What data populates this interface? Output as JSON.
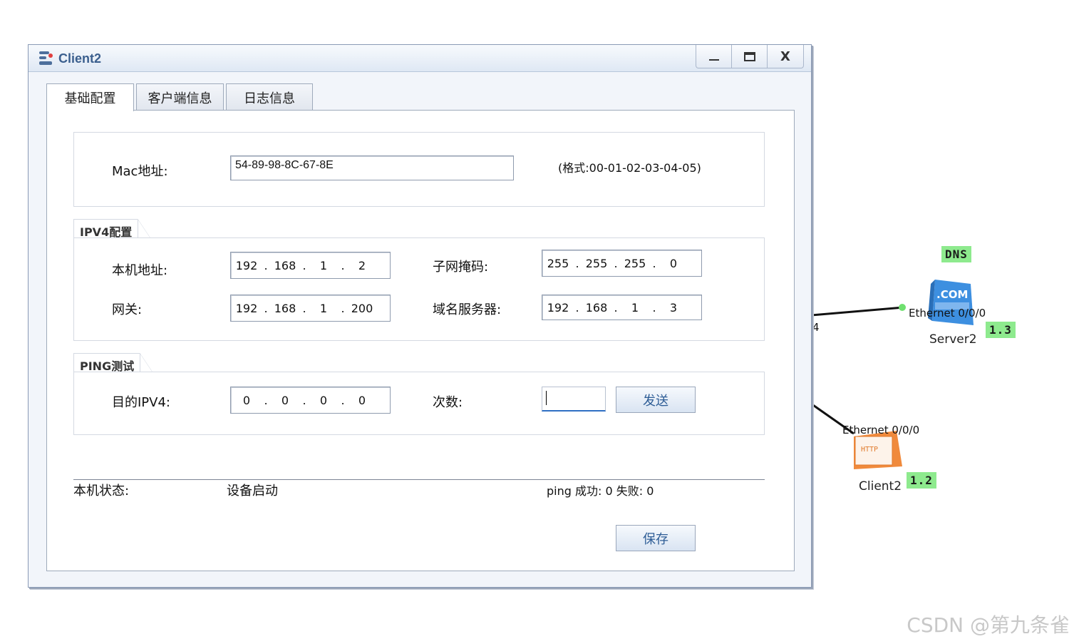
{
  "window": {
    "title": "Client2",
    "minimize": "minimize",
    "maximize": "maximize",
    "close": "X"
  },
  "tabs": [
    {
      "label": "基础配置",
      "active": true
    },
    {
      "label": "客户端信息",
      "active": false
    },
    {
      "label": "日志信息",
      "active": false
    }
  ],
  "mac": {
    "label": "Mac地址:",
    "value": "54-89-98-8C-67-8E",
    "hint": "(格式:00-01-02-03-04-05)"
  },
  "ipv4": {
    "legend": "IPV4配置",
    "local_label": "本机地址:",
    "local": [
      "192",
      "168",
      "1",
      "2"
    ],
    "mask_label": "子网掩码:",
    "mask": [
      "255",
      "255",
      "255",
      "0"
    ],
    "gateway_label": "网关:",
    "gateway": [
      "192",
      "168",
      "1",
      "200"
    ],
    "dns_label": "域名服务器:",
    "dns": [
      "192",
      "168",
      "1",
      "3"
    ]
  },
  "ping": {
    "legend": "PING测试",
    "dest_label": "目的IPV4:",
    "dest": [
      "0",
      "0",
      "0",
      "0"
    ],
    "count_label": "次数:",
    "count_value": "",
    "send_button": "发送"
  },
  "status": {
    "label": "本机状态:",
    "value": "设备启动",
    "ping_result": "ping 成功: 0 失败: 0"
  },
  "save_button": "保存",
  "topology": {
    "server": {
      "name": "Server2",
      "service_tag": "DNS",
      "ip_tag": "1.3",
      "port": "Ethernet 0/0/0",
      "icon_text": ".COM"
    },
    "client": {
      "name": "Client2",
      "ip_tag": "1.2",
      "port": "Ethernet 0/0/0",
      "icon_text": "HTTP"
    },
    "edge_label": "4"
  },
  "watermark": "CSDN @第九条雀",
  "colors": {
    "title_text": "#3b5f8e",
    "tag_green": "#8eea8e",
    "server_blue": "#3d8fe0",
    "client_orange": "#f08a3c",
    "focus_blue": "#2f6fc4"
  }
}
